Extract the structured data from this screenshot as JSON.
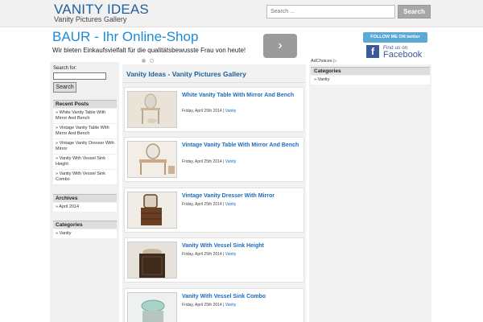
{
  "header": {
    "site_title": "VANITY IDEAS",
    "tagline": "Vanity Pictures Gallery",
    "search_placeholder": "Search ...",
    "search_button": "Search"
  },
  "ad": {
    "title": "BAUR - Ihr Online-Shop",
    "text": "Wir bieten Einkaufsvielfalt für die qualitätsbewusste Frau von heute!",
    "next_glyph": "›",
    "adchoices": "AdChoices ▷"
  },
  "social": {
    "twitter": "FOLLOW ME ON twitter",
    "facebook_find": "Find us on",
    "facebook_name": "Facebook",
    "facebook_glyph": "f"
  },
  "left_sidebar": {
    "search_label": "Search for:",
    "search_button": "Search",
    "recent_heading": "Recent Posts",
    "recent_items": [
      "» White Vanity Table With Mirror And Bench",
      "» Vintage Vanity Table With Mirror And Bench",
      "» Vintage Vanity Dresser With Mirror",
      "» Vanity With Vessel Sink Height",
      "» Vanity With Vessel Sink Combo"
    ],
    "archives_heading": "Archives",
    "archives_items": [
      "» April 2014"
    ],
    "categories_heading": "Categories",
    "categories_items": [
      "» Vanity"
    ]
  },
  "main": {
    "heading": "Vanity Ideas - Vanity Pictures Gallery",
    "posts": [
      {
        "title": "White Vanity Table With Mirror And Bench",
        "date": "Friday, April 25th 2014 | ",
        "category": "Vanity"
      },
      {
        "title": "Vintage Vanity Table With Mirror And Bench",
        "date": "Friday, April 25th 2014 | ",
        "category": "Vanity"
      },
      {
        "title": "Vintage Vanity Dresser With Mirror",
        "date": "Friday, April 25th 2014 | ",
        "category": "Vanity"
      },
      {
        "title": "Vanity With Vessel Sink Height",
        "date": "Friday, April 25th 2014 | ",
        "category": "Vanity"
      },
      {
        "title": "Vanity With Vessel Sink Combo",
        "date": "Friday, April 25th 2014 | ",
        "category": "Vanity"
      }
    ]
  },
  "right_sidebar": {
    "categories_heading": "Categories",
    "categories_items": [
      "» Vanity"
    ]
  },
  "colors": {
    "link_blue": "#1a6bbd",
    "title_blue": "#1c5f9d",
    "ad_blue": "#1e8ad6",
    "facebook_blue": "#3b5998",
    "twitter_blue": "#5aa9d6"
  }
}
